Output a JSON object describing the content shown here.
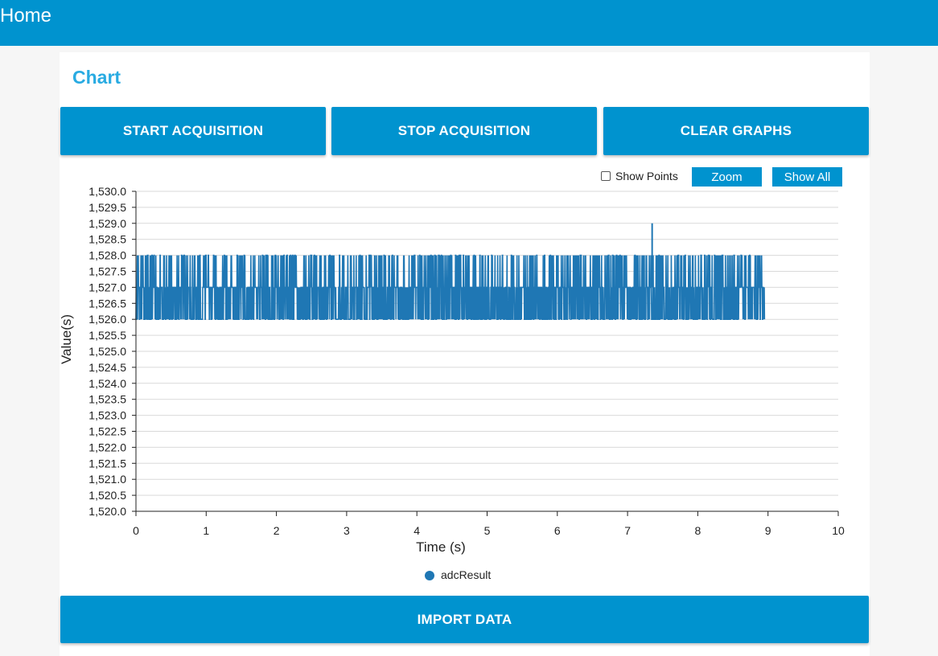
{
  "header": {
    "title": "Home"
  },
  "card": {
    "title": "Chart",
    "buttons": {
      "start": "START ACQUISITION",
      "stop": "STOP ACQUISITION",
      "clear": "CLEAR GRAPHS",
      "import": "IMPORT DATA"
    },
    "tools": {
      "show_points_label": "Show Points",
      "show_points_checked": false,
      "zoom_label": "Zoom",
      "show_all_label": "Show All"
    }
  },
  "colors": {
    "accent": "#0093cf",
    "title": "#29abe2",
    "series": "#1f77b4"
  },
  "chart_data": {
    "type": "line",
    "xlabel": "Time (s)",
    "ylabel": "Value(s)",
    "xlim": [
      0,
      10
    ],
    "ylim": [
      1520,
      1530
    ],
    "xticks": [
      "0",
      "1",
      "2",
      "3",
      "4",
      "5",
      "6",
      "7",
      "8",
      "9",
      "10"
    ],
    "yticks": [
      "1,520.0",
      "1,520.5",
      "1,521.0",
      "1,521.5",
      "1,522.0",
      "1,522.5",
      "1,523.0",
      "1,523.5",
      "1,524.0",
      "1,524.5",
      "1,525.0",
      "1,525.5",
      "1,526.0",
      "1,526.5",
      "1,527.0",
      "1,527.5",
      "1,528.0",
      "1,528.5",
      "1,529.0",
      "1,529.5",
      "1,530.0"
    ],
    "grid": true,
    "legend": "bottom",
    "series": [
      {
        "name": "adcResult",
        "x_start": 0,
        "x_end": 8.95,
        "band_min": 1526,
        "band_max": 1528,
        "typical_value": 1527,
        "spike": {
          "x": 7.35,
          "y": 1529
        }
      }
    ]
  }
}
